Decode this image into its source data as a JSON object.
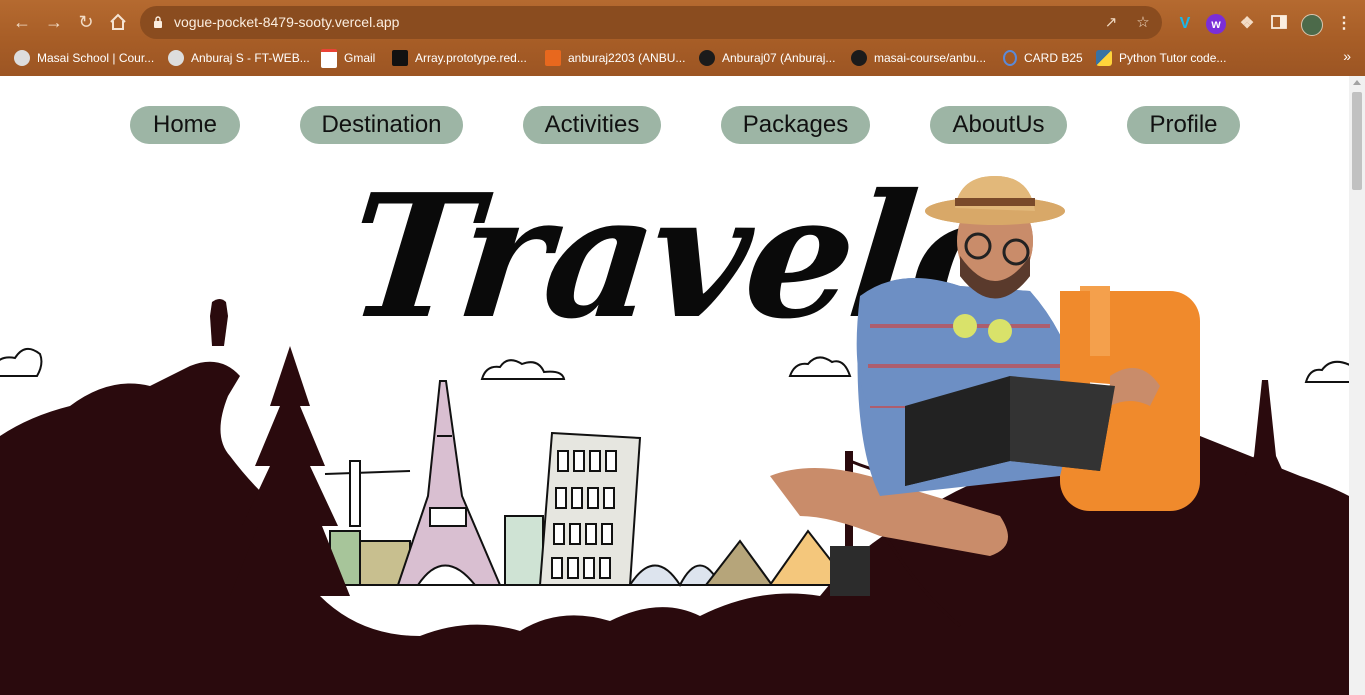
{
  "browser": {
    "url": "vogue-pocket-8479-sooty.vercel.app",
    "bookmarks": [
      {
        "label": "Masai School | Cour...",
        "icon": "globe-icon"
      },
      {
        "label": "Anburaj S - FT-WEB...",
        "icon": "globe-icon"
      },
      {
        "label": "Gmail",
        "icon": "gmail-icon"
      },
      {
        "label": "Array.prototype.red...",
        "icon": "mdn-icon"
      },
      {
        "label": "anburaj2203 (ANBU...",
        "icon": "codepen-icon"
      },
      {
        "label": "Anburaj07 (Anburaj...",
        "icon": "github-icon"
      },
      {
        "label": "masai-course/anbu...",
        "icon": "github-icon"
      },
      {
        "label": "CARD B25",
        "icon": "ring-icon"
      },
      {
        "label": "Python Tutor code...",
        "icon": "python-icon"
      }
    ]
  },
  "nav": {
    "items": [
      "Home",
      "Destination",
      "Activities",
      "Packages",
      "AboutUs",
      "Profile"
    ]
  },
  "hero": {
    "title": "Travelo"
  },
  "colors": {
    "pill": "#9db5a5",
    "silhouette": "#2a0a0d",
    "chrome": "#a85e27"
  }
}
